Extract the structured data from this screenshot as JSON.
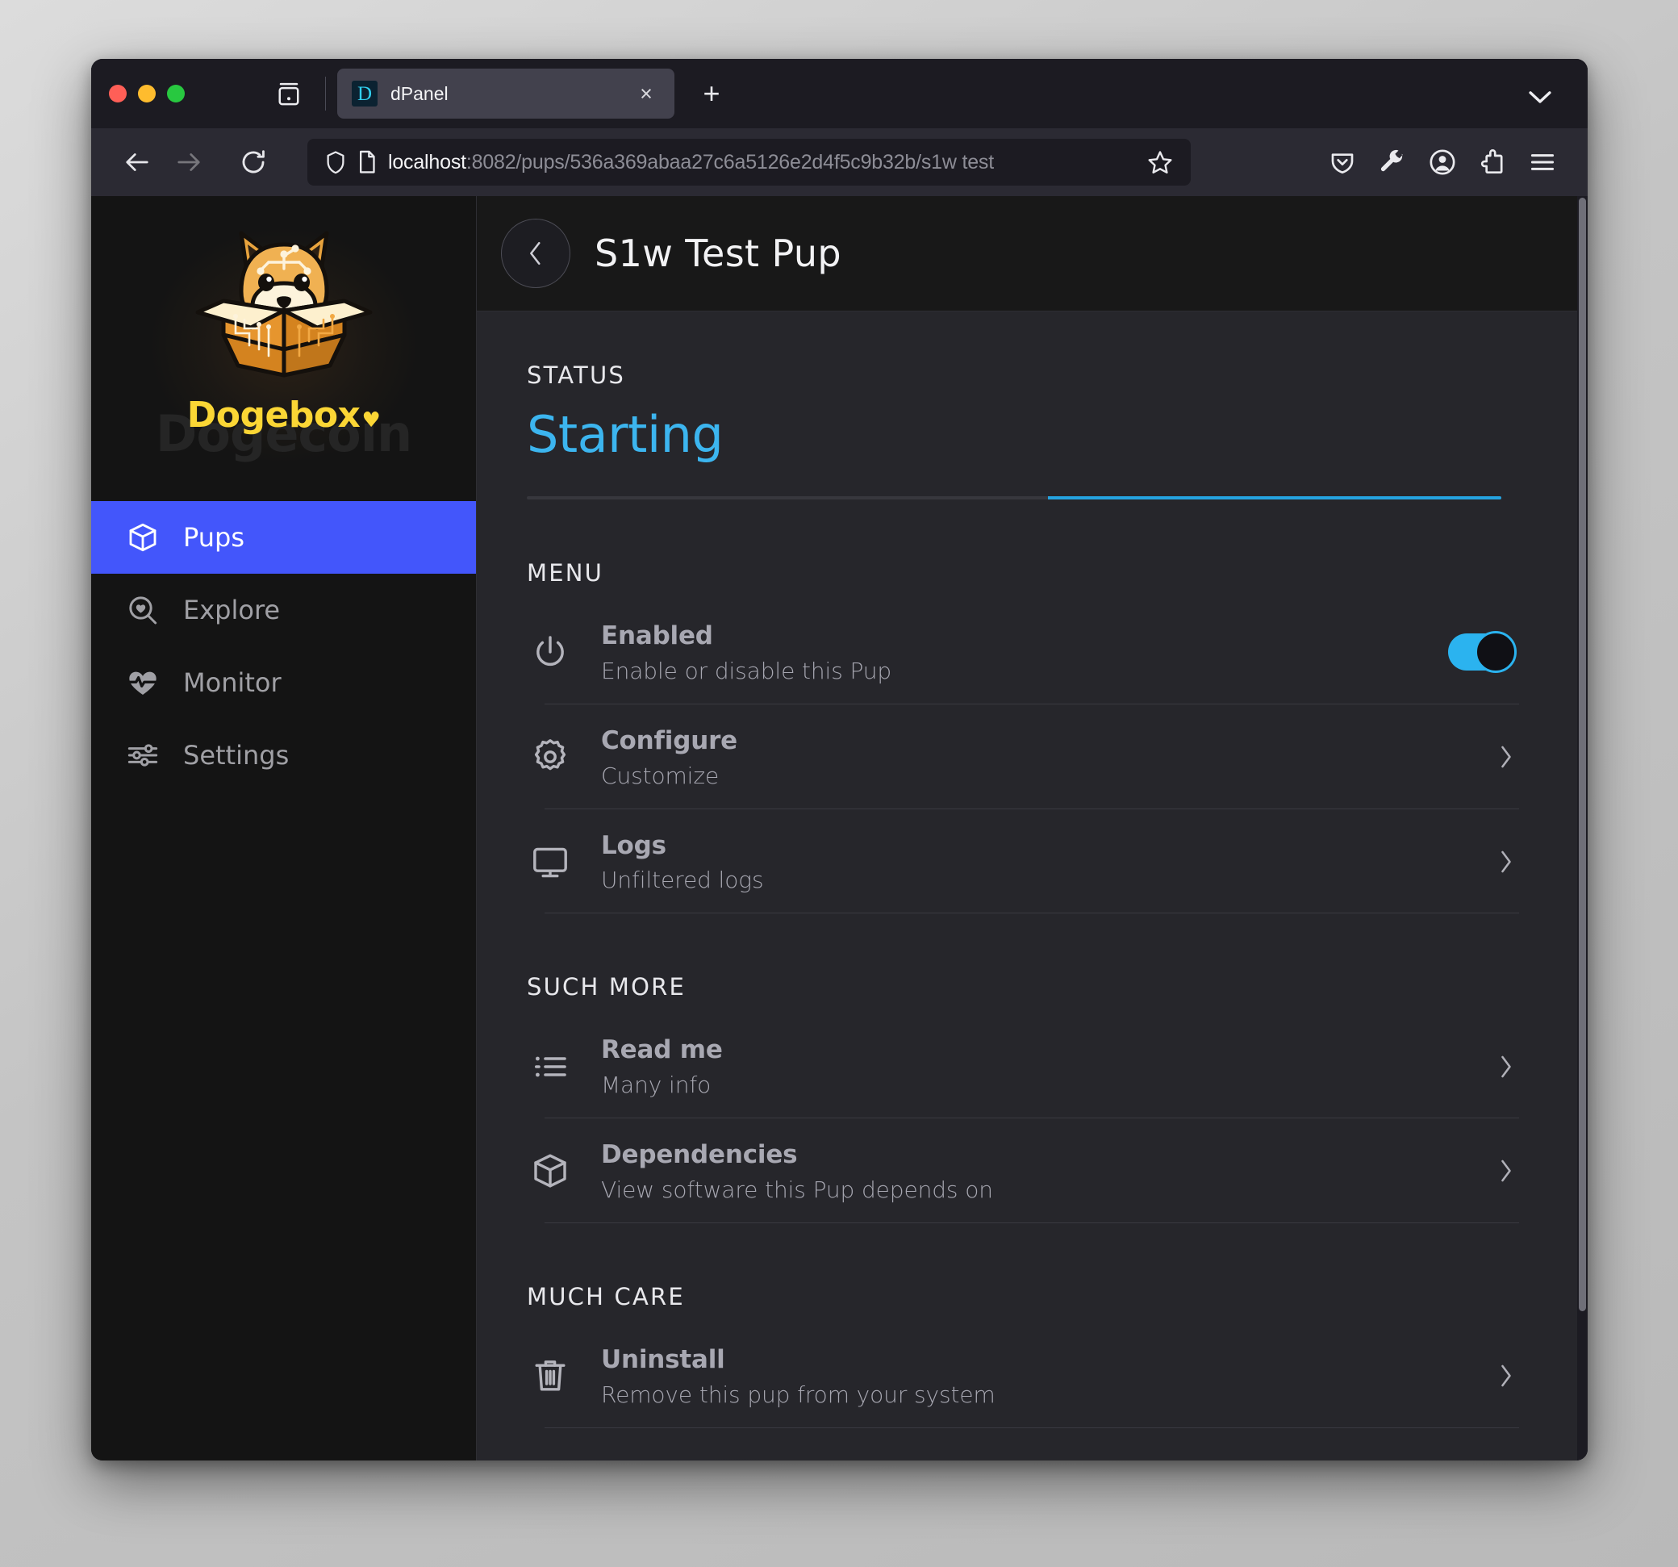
{
  "browser": {
    "traffic_lights": [
      "close",
      "minimize",
      "zoom"
    ],
    "firefox_view_label": "Firefox View",
    "tab": {
      "favicon_letter": "D",
      "title": "dPanel",
      "close_label": "×"
    },
    "new_tab_label": "+",
    "list_all_tabs_label": "v",
    "nav": {
      "back_label": "Back",
      "forward_label": "Forward",
      "reload_label": "Reload"
    },
    "urlbar": {
      "host": "localhost",
      "path": ":8082/pups/536a369abaa27c6a5126e2d4f5c9b32b/s1w test",
      "shield_icon": "shield-icon",
      "page_icon": "page-icon",
      "bookmark_icon": "star-icon"
    },
    "toolbar_icons": [
      "pocket-icon",
      "wrench-icon",
      "account-icon",
      "extensions-icon",
      "app-menu-icon"
    ]
  },
  "sidebar": {
    "brand": {
      "name": "Dogebox",
      "heart": "♥",
      "watermark": "Dogecoin",
      "logo_icon": "dogebox-shiba-logo"
    },
    "items": [
      {
        "label": "Pups",
        "icon": "package-icon",
        "active": true
      },
      {
        "label": "Explore",
        "icon": "search-heart-icon",
        "active": false
      },
      {
        "label": "Monitor",
        "icon": "heart-pulse-icon",
        "active": false
      },
      {
        "label": "Settings",
        "icon": "sliders-icon",
        "active": false
      }
    ]
  },
  "main": {
    "header": {
      "back_icon": "chevron-left-icon",
      "title": "S1w Test Pup"
    },
    "status": {
      "label": "STATUS",
      "value": "Starting",
      "value_color": "#3cb5ef",
      "progress_indeterminate": true
    },
    "sections": [
      {
        "label": "MENU",
        "rows": [
          {
            "icon": "power-icon",
            "title": "Enabled",
            "sub": "Enable or disable this Pup",
            "control": "toggle",
            "toggle_on": true
          },
          {
            "icon": "gear-icon",
            "title": "Configure",
            "sub": "Customize",
            "control": "chevron"
          },
          {
            "icon": "monitor-icon",
            "title": "Logs",
            "sub": "Unfiltered logs",
            "control": "chevron"
          }
        ]
      },
      {
        "label": "SUCH MORE",
        "rows": [
          {
            "icon": "list-icon",
            "title": "Read me",
            "sub": "Many info",
            "control": "chevron"
          },
          {
            "icon": "package-icon",
            "title": "Dependencies",
            "sub": "View software this Pup depends on",
            "control": "chevron"
          }
        ]
      },
      {
        "label": "MUCH CARE",
        "rows": [
          {
            "icon": "trash-icon",
            "title": "Uninstall",
            "sub": "Remove this pup from your system",
            "control": "chevron"
          }
        ]
      }
    ]
  },
  "colors": {
    "accent_blue": "#4356fb",
    "status_cyan": "#3cb5ef",
    "brand_yellow": "#fbd635",
    "sidebar_bg": "#141414",
    "main_bg": "#26262b"
  }
}
